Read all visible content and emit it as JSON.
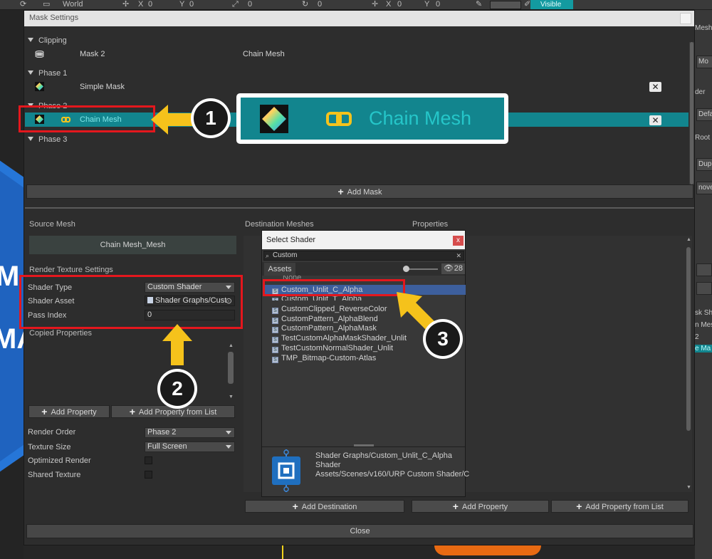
{
  "background": {
    "toolbar": {
      "space": "World",
      "pos_x_label": "X",
      "pos_x": "0",
      "pos_y_label": "Y",
      "pos_y": "0",
      "scale": "0",
      "rotation": "0",
      "pivot_x_label": "X",
      "pivot_x": "0",
      "pivot_y_label": "Y",
      "pivot_y": "0",
      "visible": "Visible"
    },
    "right_panel": {
      "mesh_label": "Mesh",
      "mode_btn": "Mo",
      "header_label": "der",
      "default_btn": "Defa",
      "root_label": "Root",
      "duplicate_btn": "Dupli",
      "remove_btn": "nove",
      "mask_label": "sk Sh",
      "mesh_label2": "n Mes",
      "num_label": "2",
      "mask_btn": "e Ma"
    },
    "left_logo": {
      "line1": "M",
      "line2": "MA"
    }
  },
  "dialog": {
    "title": "Mask Settings",
    "phases": [
      {
        "name": "Clipping"
      },
      {
        "name": "Phase 1"
      },
      {
        "name": "Phase 2"
      },
      {
        "name": "Phase 3"
      }
    ],
    "masks": {
      "clip_mask": "Mask 2",
      "clip_target": "Chain Mesh",
      "simple_mask": "Simple Mask",
      "chain_mesh": "Chain Mesh"
    },
    "zoom_label": "Chain Mesh",
    "add_mask": "Add Mask",
    "source_mesh_header": "Source Mesh",
    "source_mesh_value": "Chain Mesh_Mesh",
    "render_texture_settings": "Render Texture Settings",
    "shader_type_label": "Shader Type",
    "shader_type_value": "Custom Shader",
    "shader_asset_label": "Shader Asset",
    "shader_asset_value": "Shader Graphs/Cust",
    "pass_index_label": "Pass Index",
    "pass_index_value": "0",
    "copied_properties": "Copied Properties",
    "add_property": "Add Property",
    "add_property_from_list": "Add Property from List",
    "render_order_label": "Render Order",
    "render_order_value": "Phase 2",
    "texture_size_label": "Texture Size",
    "texture_size_value": "Full Screen",
    "optimized_render_label": "Optimized Render",
    "shared_texture_label": "Shared Texture",
    "destination_meshes": "Destination Meshes",
    "properties": "Properties",
    "add_destination": "Add Destination",
    "add_property_dest": "Add Property",
    "add_property_from_list_dest": "Add Property from List",
    "close": "Close"
  },
  "shader_popup": {
    "title": "Select Shader",
    "close_glyph": "x",
    "search_value": "Custom",
    "tab_assets": "Assets",
    "count": "28",
    "partial_header": "None",
    "items": [
      "Custom_Unlit_C_Alpha",
      "Custom_Unlit_T_Alpha",
      "CustomClipped_ReverseColor",
      "CustomPattern_AlphaBlend",
      "CustomPattern_AlphaMask",
      "TestCustomAlphaMaskShader_Unlit",
      "TestCustomNormalShader_Unlit",
      "TMP_Bitmap-Custom-Atlas"
    ],
    "selected_index": 0,
    "info_name": "Shader Graphs/Custom_Unlit_C_Alpha",
    "info_type": "Shader",
    "info_path": "Assets/Scenes/v160/URP Custom Shader/C"
  },
  "annotations": {
    "badge_1": "1",
    "badge_2": "2",
    "badge_3": "3"
  },
  "colors": {
    "selection_teal": "#12858e",
    "annotation_red": "#e4171d",
    "annotation_yellow": "#f5c21b",
    "list_selection_blue": "#3d5f9d"
  }
}
